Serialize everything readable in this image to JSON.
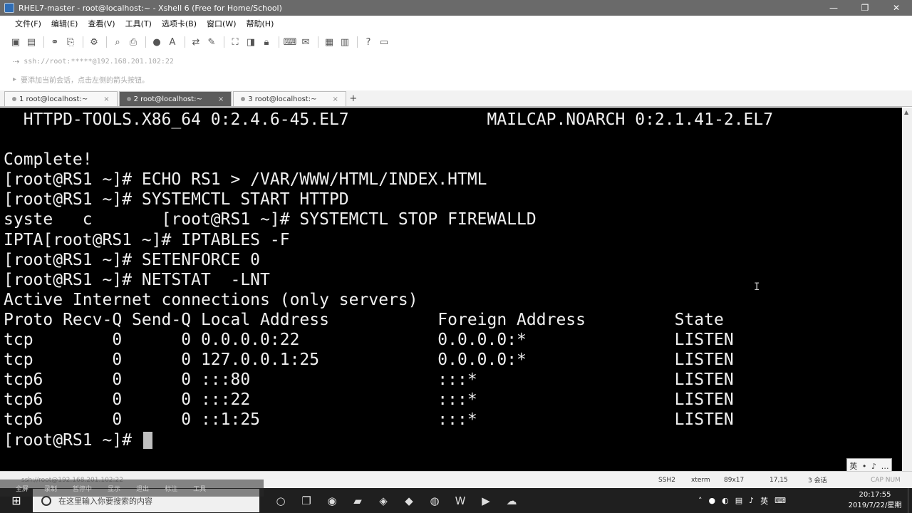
{
  "window": {
    "title": "RHEL7-master - root@localhost:~ - Xshell 6 (Free for Home/School)",
    "controls": [
      "—",
      "❐",
      "✕"
    ]
  },
  "menu": {
    "items": [
      "文件(F)",
      "编辑(E)",
      "查看(V)",
      "工具(T)",
      "选项卡(B)",
      "窗口(W)",
      "帮助(H)"
    ]
  },
  "address": {
    "text": "ssh://root:*****@192.168.201.102:22"
  },
  "info": {
    "text": "要添加当前会话，点击左侧的箭头按钮。"
  },
  "tabs": [
    {
      "label": "1 root@localhost:~",
      "active": false
    },
    {
      "label": "2 root@localhost:~",
      "active": true
    },
    {
      "label": "3 root@localhost:~",
      "active": false
    }
  ],
  "tab_add": "+",
  "terminal": {
    "lines": [
      "  HTTPD-TOOLS.X86_64 0:2.4.6-45.EL7              MAILCAP.NOARCH 0:2.1.41-2.EL7",
      "",
      "Complete!",
      "[root@RS1 ~]# ECHO RS1 > /VAR/WWW/HTML/INDEX.HTML",
      "[root@RS1 ~]# SYSTEMCTL START HTTPD",
      "syste   c       [root@RS1 ~]# SYSTEMCTL STOP FIREWALLD",
      "IPTA[root@RS1 ~]# IPTABLES -F",
      "[root@RS1 ~]# SETENFORCE 0",
      "[root@RS1 ~]# NETSTAT  -LNT",
      "Active Internet connections (only servers)",
      "Proto Recv-Q Send-Q Local Address           Foreign Address         State",
      "tcp        0      0 0.0.0.0:22              0.0.0.0:*               LISTEN",
      "tcp        0      0 127.0.0.1:25            0.0.0.0:*               LISTEN",
      "tcp6       0      0 :::80                   :::*                    LISTEN",
      "tcp6       0      0 :::22                   :::*                    LISTEN",
      "tcp6       0      0 ::1:25                  :::*                    LISTEN"
    ],
    "prompt": "[root@RS1 ~]# "
  },
  "ime": {
    "items": [
      "英",
      "•",
      "♪",
      "…"
    ]
  },
  "status": {
    "left": "ssh://root@192.168.201.102:22",
    "protocol": "SSH2",
    "term": "xterm",
    "size": "89x17",
    "cursor_pos": "17,15",
    "sessions": "3 会话",
    "caps": "CAP NUM"
  },
  "overlay": {
    "items": [
      "全屏",
      "录制",
      "暂停中",
      "显示",
      "退出",
      "标注",
      "工具"
    ]
  },
  "taskbar": {
    "search_placeholder": "在这里输入你要搜索的内容",
    "time": "20:17:55",
    "date": "2019/7/22/星期一",
    "lang": "英"
  }
}
